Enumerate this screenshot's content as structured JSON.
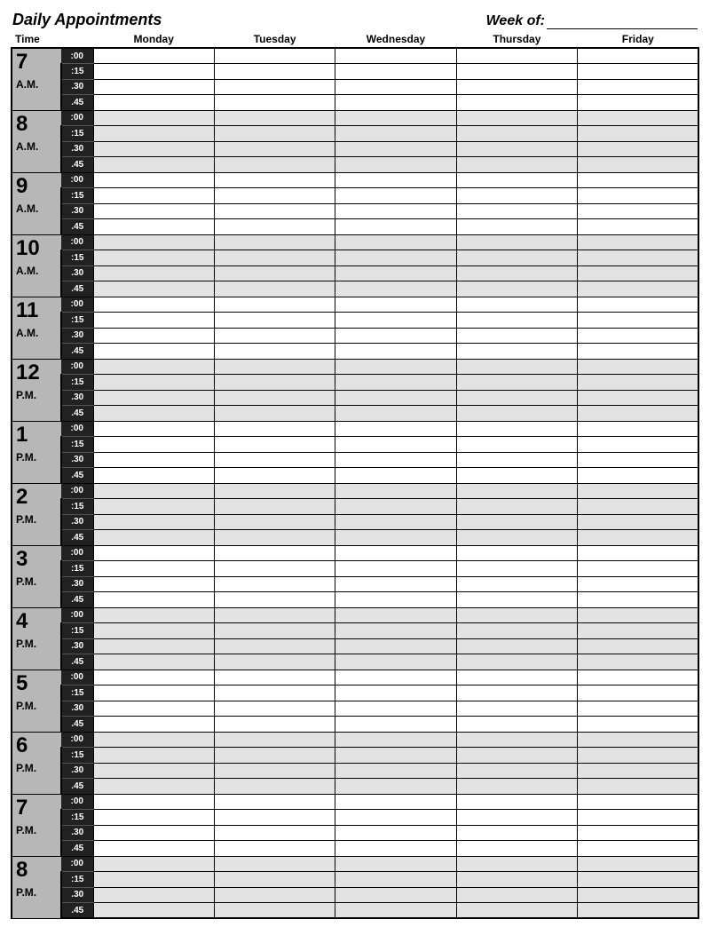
{
  "header": {
    "title": "Daily Appointments",
    "week_of_label": "Week of:"
  },
  "columns": {
    "time": "Time",
    "days": [
      "Monday",
      "Tuesday",
      "Wednesday",
      "Thursday",
      "Friday"
    ]
  },
  "minutes": [
    ":00",
    ":15",
    ".30",
    ".45"
  ],
  "hours": [
    {
      "num": "7",
      "ampm": "A.M.",
      "shaded": false
    },
    {
      "num": "8",
      "ampm": "A.M.",
      "shaded": true
    },
    {
      "num": "9",
      "ampm": "A.M.",
      "shaded": false
    },
    {
      "num": "10",
      "ampm": "A.M.",
      "shaded": true
    },
    {
      "num": "11",
      "ampm": "A.M.",
      "shaded": false
    },
    {
      "num": "12",
      "ampm": "P.M.",
      "shaded": true
    },
    {
      "num": "1",
      "ampm": "P.M.",
      "shaded": false
    },
    {
      "num": "2",
      "ampm": "P.M.",
      "shaded": true
    },
    {
      "num": "3",
      "ampm": "P.M.",
      "shaded": false
    },
    {
      "num": "4",
      "ampm": "P.M.",
      "shaded": true
    },
    {
      "num": "5",
      "ampm": "P.M.",
      "shaded": false
    },
    {
      "num": "6",
      "ampm": "P.M.",
      "shaded": true
    },
    {
      "num": "7",
      "ampm": "P.M.",
      "shaded": false
    },
    {
      "num": "8",
      "ampm": "P.M.",
      "shaded": true
    }
  ]
}
